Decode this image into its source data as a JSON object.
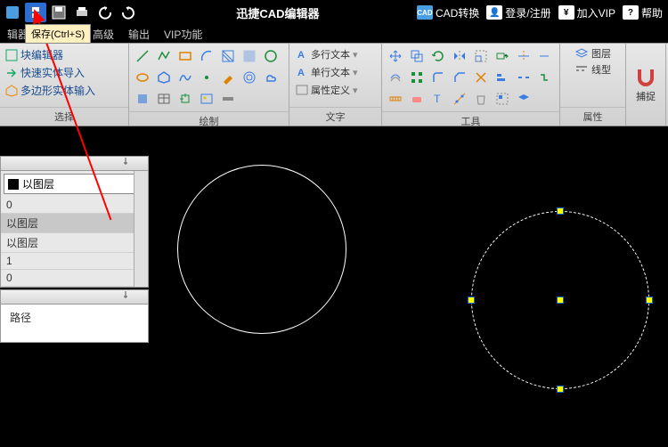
{
  "app_title": "迅捷CAD编辑器",
  "tooltip": "保存(Ctrl+S)",
  "top_right": {
    "cad": "CAD",
    "convert": "CAD转换",
    "login": "登录/注册",
    "vip": "加入VIP",
    "help": "帮助"
  },
  "menu": {
    "editor": "辑器",
    "advanced": "高级",
    "output": "输出",
    "vip": "VIP功能"
  },
  "sidebar_select": {
    "block_edit": "块编辑器",
    "quick_import": "快速实体导入",
    "poly_input": "多边形实体输入",
    "label": "选择"
  },
  "ribbon": {
    "draw": "绘制",
    "text_group": "文字",
    "multi_text": "多行文本",
    "single_text": "单行文本",
    "attr_def": "属性定义",
    "tools": "工具",
    "props": "属性",
    "layer": "图层",
    "linetype": "线型",
    "snap": "捕捉"
  },
  "props_panel": {
    "combo": "以图层",
    "rows": [
      "0",
      "以图层",
      "以图层",
      "1",
      "0"
    ],
    "path": "路径"
  }
}
